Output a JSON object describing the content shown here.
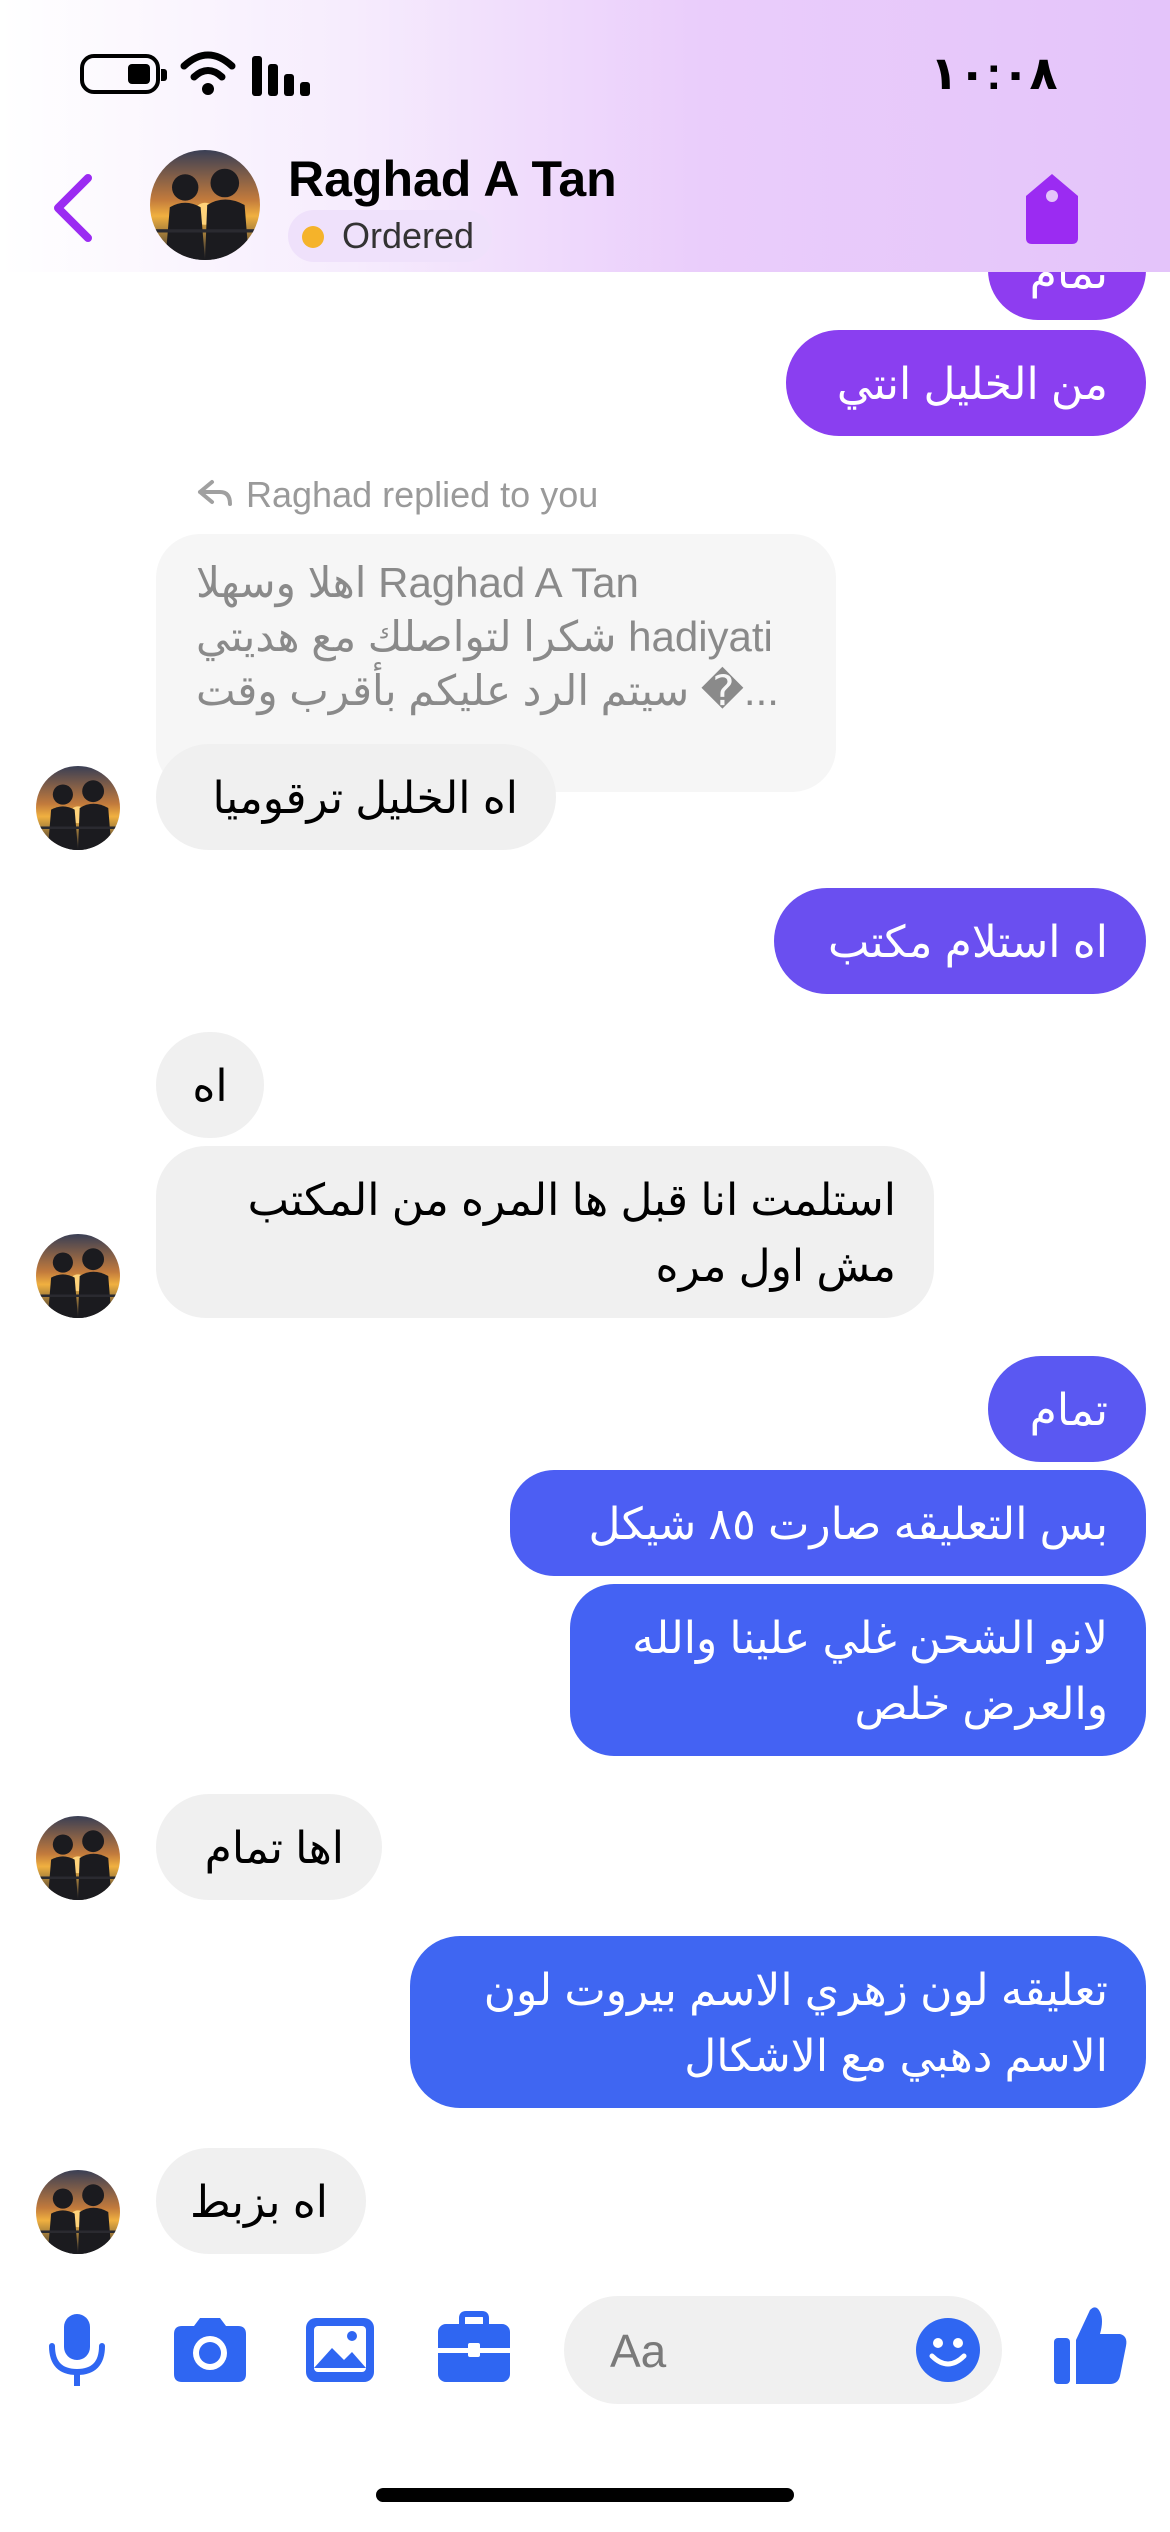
{
  "status": {
    "time": "١٠:٠٨"
  },
  "header": {
    "name": "Raghad A Tan",
    "status_label": "Ordered"
  },
  "colors": {
    "accent": "#9b2bf2",
    "out_top": "#8e3df0",
    "out_bottom": "#3c64f2",
    "ordered_dot": "#f5b32a"
  },
  "messages": {
    "m0": "تمام",
    "m1": "من الخليل انتي",
    "reply_label": "Raghad replied to you",
    "quoted": "اهلا وسهلا Raghad A Tan\nشكرا لتواصلك مع هديتي hadiyati\nسيتم الرد عليكم بأقرب وقت �...",
    "m2": "اه الخليل ترقوميا",
    "m3": "اه استلام مكتب",
    "m4": "اه",
    "m5_l1": "استلمت انا قبل ها المره من المكتب",
    "m5_l2": "مش اول مره",
    "m6": "تمام",
    "m7": "بس التعليقه صارت ٨٥ شيكل",
    "m8_l1": "لانو الشحن غلي علينا والله",
    "m8_l2": "والعرض خلص",
    "m9": "اها تمام",
    "m10_l1": "تعليقه لون زهري الاسم بيروت لون",
    "m10_l2": "الاسم دهبي مع الاشكال",
    "m11": "اه بزبط"
  },
  "composer": {
    "placeholder": "Aa"
  },
  "icons": {
    "back": "chevron-left-icon",
    "tag": "tag-icon",
    "mic": "microphone-icon",
    "camera": "camera-icon",
    "gallery": "image-icon",
    "briefcase": "briefcase-icon",
    "emoji": "smiley-icon",
    "like": "thumbs-up-icon"
  }
}
